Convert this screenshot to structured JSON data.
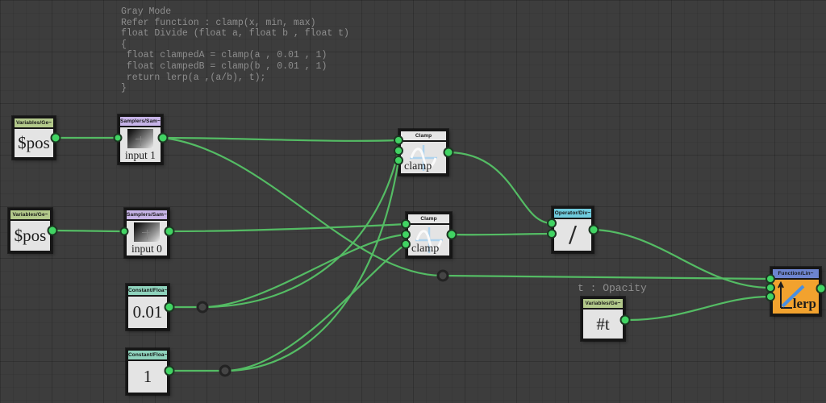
{
  "comment": {
    "text": "Gray Mode\nRefer function : clamp(x, min, max)\nfloat Divide (float a, float b , float t)\n{\n float clampedA = clamp(a , 0.01 , 1)\n float clampedB = clamp(b , 0.01 , 1)\n return lerp(a ,(a/b), t);\n}"
  },
  "labels": {
    "t_opacity": "t : Opacity"
  },
  "nodes": {
    "pos1": {
      "header": "Variables/Ge~",
      "label": "$pos"
    },
    "sampler1": {
      "header": "Samplers/Sam~",
      "label": "input 1"
    },
    "pos2": {
      "header": "Variables/Ge~",
      "label": "$pos"
    },
    "sampler0": {
      "header": "Samplers/Sam~",
      "label": "input 0"
    },
    "clamp1": {
      "header": "Clamp",
      "label": "clamp"
    },
    "clamp2": {
      "header": "Clamp",
      "label": "clamp"
    },
    "const001": {
      "header": "Constant/Floa~",
      "label": "0.01"
    },
    "const1": {
      "header": "Constant/Floa~",
      "label": "1"
    },
    "divide": {
      "header": "Operator/Div~",
      "label": "/"
    },
    "t": {
      "header": "Variables/Ge~",
      "label": "#t"
    },
    "lerp": {
      "header": "Function/Lin~",
      "label": "lerp"
    }
  },
  "colors": {
    "canvas": "#3d3d3d",
    "wire": "#54bc64",
    "port": "#41d463",
    "port_ring": "#1d3723",
    "knot": "#454545",
    "knot_ring": "#232323",
    "node_body": "#e4e4e4",
    "node_border": "#161616",
    "header_variables": "#b3c98b",
    "header_samplers": "#c7b4e8",
    "header_clamp": "#e6e6e6",
    "header_constant": "#8fd3bd",
    "header_operator": "#6fcbdd",
    "header_function": "#6d84cf",
    "lerp_body": "#f2a22e",
    "comment_text": "#8e8e8e",
    "icon_blue": "#aed3ee",
    "icon_diag_blue": "#4a8fe0"
  }
}
